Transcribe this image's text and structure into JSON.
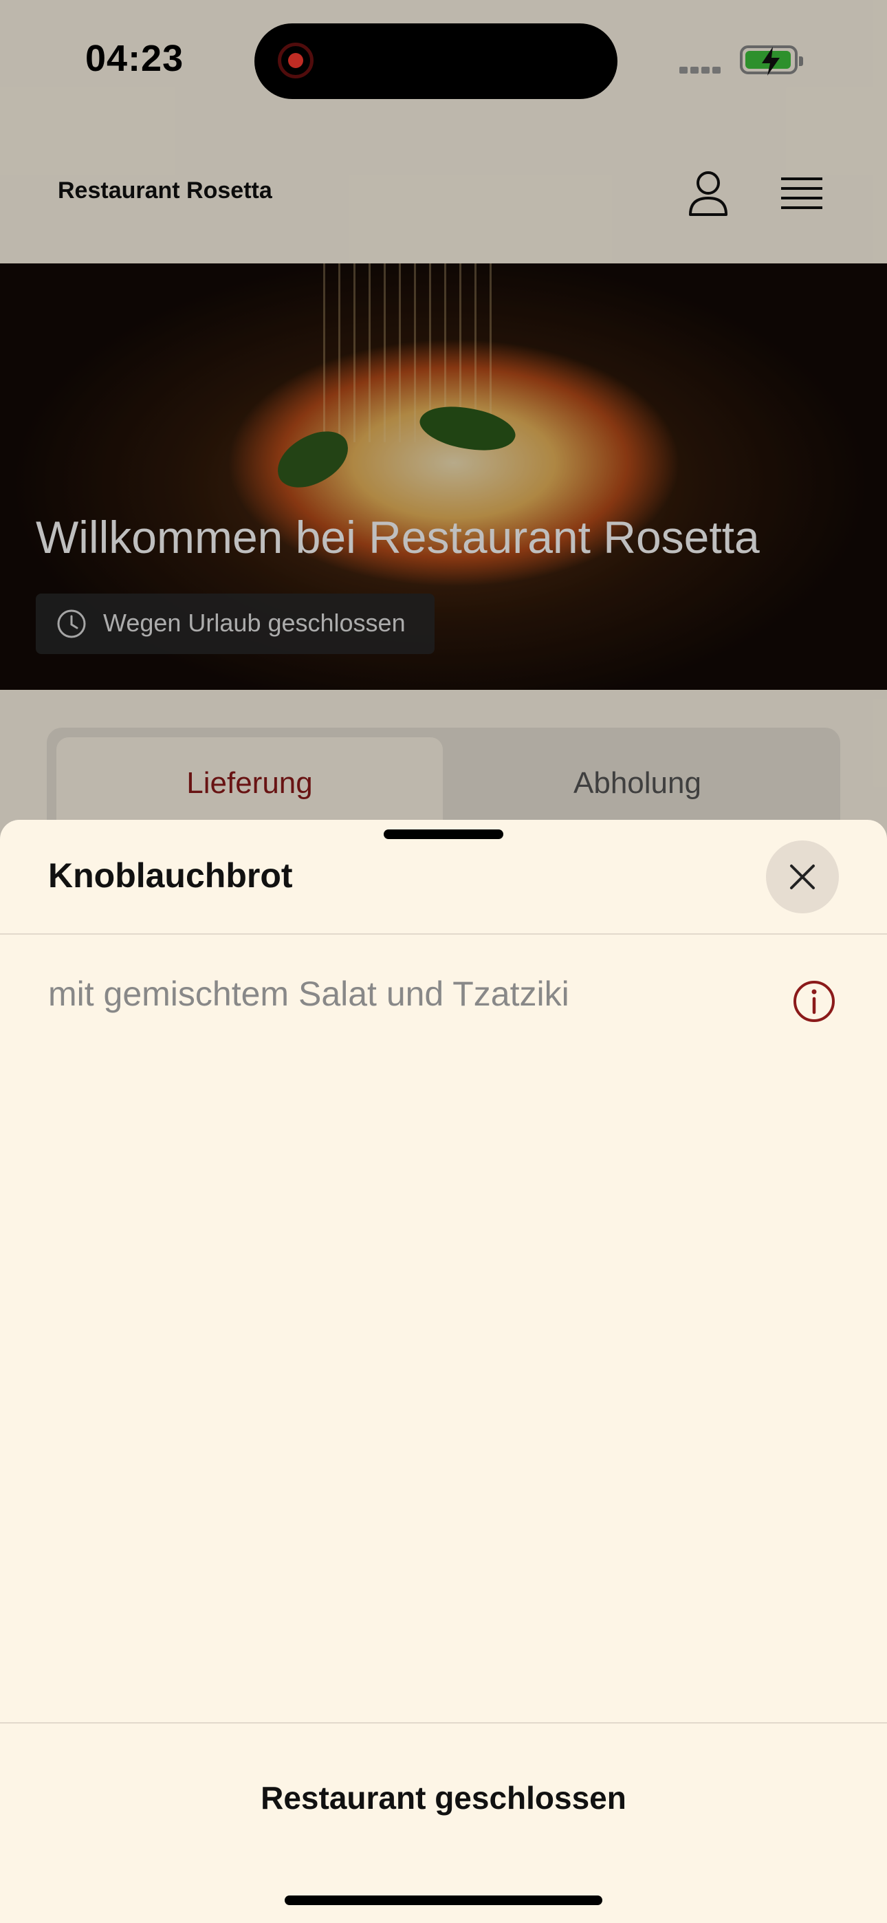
{
  "status_bar": {
    "time": "04:23"
  },
  "header": {
    "brand": "Restaurant Rosetta",
    "icons": [
      "user-icon",
      "menu-icon"
    ]
  },
  "hero": {
    "title": "Willkommen bei Restaurant Rosetta",
    "status_badge": "Wegen Urlaub geschlossen"
  },
  "tabs": {
    "delivery": "Lieferung",
    "pickup": "Abholung",
    "selected": "Lieferung"
  },
  "sheet": {
    "title": "Knoblauchbrot",
    "description": "mit gemischtem Salat und Tzatziki",
    "footer_button": "Restaurant geschlossen"
  },
  "colors": {
    "accent": "#8b1a1a",
    "background": "#fdf5e6",
    "battery": "#3cc13b",
    "recording": "#ff3b30"
  }
}
